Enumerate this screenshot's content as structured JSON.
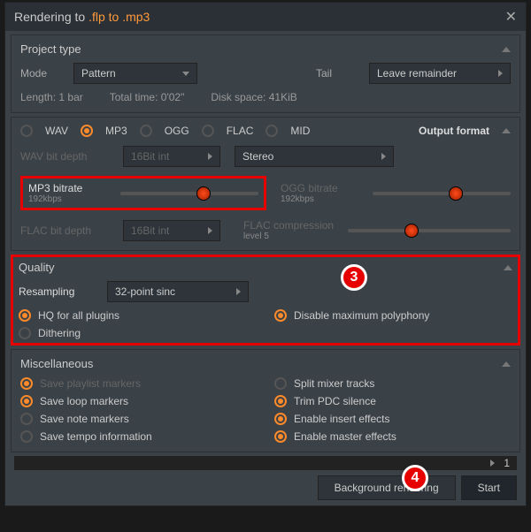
{
  "title_prefix": "Rendering to ",
  "title_highlight": ".flp to .mp3",
  "sections": {
    "project": {
      "title": "Project type",
      "mode_label": "Mode",
      "mode_value": "Pattern",
      "tail_label": "Tail",
      "tail_value": "Leave remainder",
      "length_label": "Length:",
      "length_value": "1 bar",
      "total_time_label": "Total time:",
      "total_time_value": "0'02\"",
      "disk_label": "Disk space:",
      "disk_value": "41KiB"
    },
    "format": {
      "title": "Output format",
      "options": [
        "WAV",
        "MP3",
        "OGG",
        "FLAC",
        "MID"
      ],
      "selected": "MP3",
      "wav_depth_label": "WAV bit depth",
      "wav_depth_value": "16Bit int",
      "stereo_label": "Stereo",
      "mp3_label": "MP3 bitrate",
      "mp3_value": "192kbps",
      "ogg_label": "OGG bitrate",
      "ogg_value": "192kbps",
      "flac_depth_label": "FLAC bit depth",
      "flac_depth_value": "16Bit int",
      "flac_comp_label": "FLAC compression",
      "flac_comp_value": "level 5"
    },
    "quality": {
      "title": "Quality",
      "resampling_label": "Resampling",
      "resampling_value": "32-point sinc",
      "opts": {
        "hq": "HQ for all plugins",
        "disable_poly": "Disable maximum polyphony",
        "dithering": "Dithering"
      }
    },
    "misc": {
      "title": "Miscellaneous",
      "opts": {
        "save_playlist": "Save playlist markers",
        "split_mixer": "Split mixer tracks",
        "save_loop": "Save loop markers",
        "trim_pdc": "Trim PDC silence",
        "save_note": "Save note markers",
        "enable_insert": "Enable insert effects",
        "save_tempo": "Save tempo information",
        "enable_master": "Enable master effects"
      }
    }
  },
  "progress_count": "1",
  "buttons": {
    "background": "Background rendering",
    "start": "Start"
  },
  "callouts": {
    "c3": "3",
    "c4": "4"
  }
}
